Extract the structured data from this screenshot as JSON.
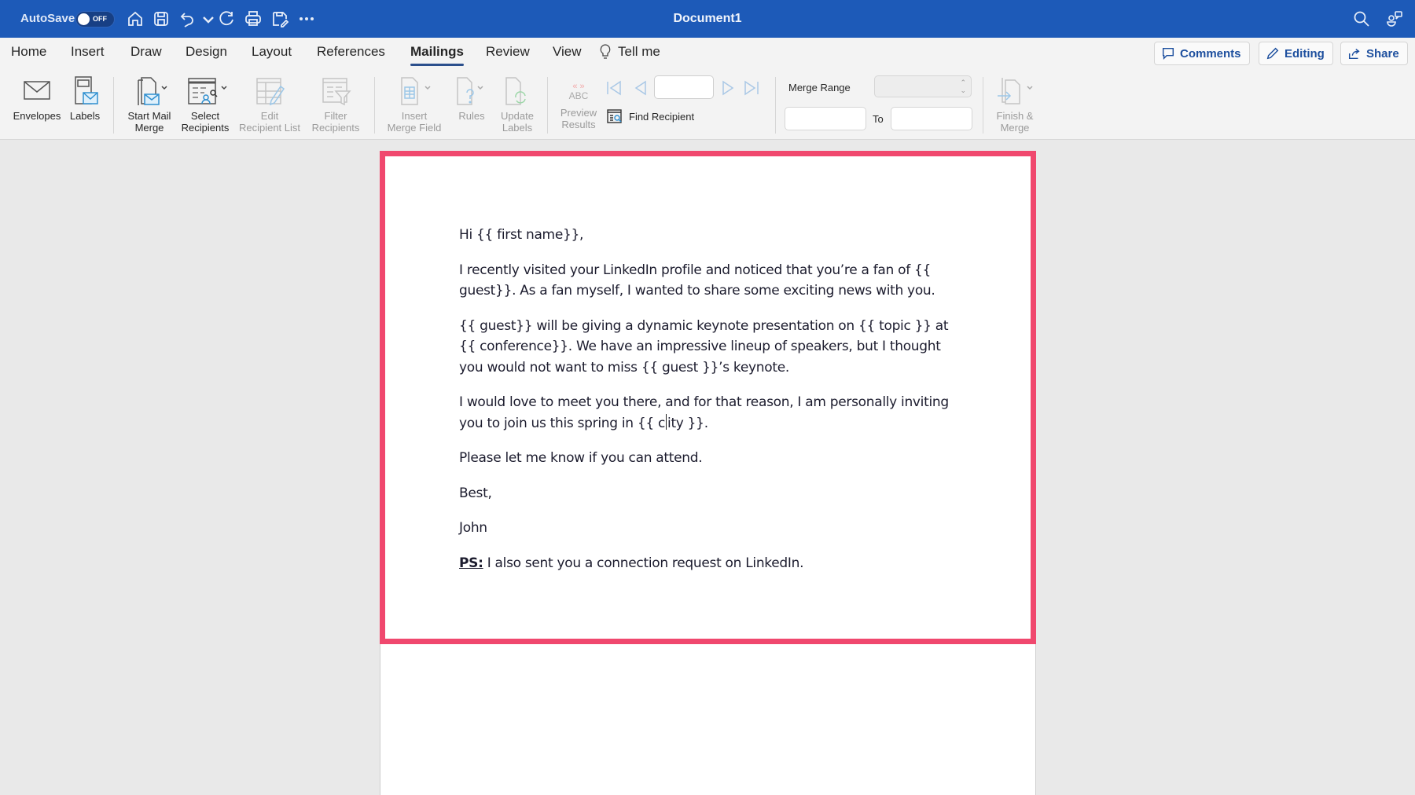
{
  "titlebar": {
    "autosave_label": "AutoSave",
    "autosave_state": "OFF",
    "document_title": "Document1",
    "quick_access": [
      "home-icon",
      "save-icon",
      "undo-icon",
      "undo-dropdown-icon",
      "redo-icon",
      "print-icon",
      "save-as-icon",
      "more-icon"
    ],
    "right_icons": [
      "search-icon",
      "share-people-icon"
    ]
  },
  "tabs": {
    "items": [
      {
        "label": "Home"
      },
      {
        "label": "Insert"
      },
      {
        "label": "Draw"
      },
      {
        "label": "Design"
      },
      {
        "label": "Layout"
      },
      {
        "label": "References"
      },
      {
        "label": "Mailings",
        "active": true
      },
      {
        "label": "Review"
      },
      {
        "label": "View"
      }
    ],
    "tell_me": "Tell me",
    "comments_label": "Comments",
    "editing_label": "Editing",
    "share_label": "Share"
  },
  "ribbon": {
    "envelopes": "Envelopes",
    "labels": "Labels",
    "start_mail_merge": [
      "Start Mail",
      "Merge"
    ],
    "select_recipients": [
      "Select",
      "Recipients"
    ],
    "edit_recipient_list": [
      "Edit",
      "Recipient List"
    ],
    "filter_recipients": [
      "Filter",
      "Recipients"
    ],
    "insert_merge_field": [
      "Insert",
      "Merge Field"
    ],
    "rules": "Rules",
    "update_labels": [
      "Update",
      "Labels"
    ],
    "preview_results": [
      "Preview",
      "Results"
    ],
    "preview_icon_text": "ABC",
    "find_recipient": "Find Recipient",
    "record_value": "",
    "merge_range_label": "Merge Range",
    "merge_range_value": "",
    "from_value": "",
    "to_label": "To",
    "to_value": "",
    "finish_merge": [
      "Finish &",
      "Merge"
    ]
  },
  "document": {
    "greeting": "Hi {{ first name}},",
    "paragraph1": "I recently visited your LinkedIn profile and noticed that you’re a fan of {{ guest}}. As a fan myself, I wanted to share some exciting news with you.",
    "paragraph2": "{{ guest}} will be giving a dynamic keynote presentation on {{ topic }} at {{ conference}}. We have an impressive lineup of speakers, but I thought you would not want to miss {{ guest }}’s keynote.",
    "paragraph3_before_caret": "I would love to meet you there, and for that reason, I am personally inviting you to join us this spring in {{ c",
    "paragraph3_after_caret": "ity }}.",
    "paragraph4": "Please let me know if you can attend.",
    "signoff": "Best,",
    "signature": "John",
    "ps_label": "PS:",
    "ps_text": " I also sent you a connection request on LinkedIn."
  },
  "colors": {
    "titlebar": "#1d5ab8",
    "highlight_border": "#f0486e",
    "accent": "#1d4f9e"
  }
}
